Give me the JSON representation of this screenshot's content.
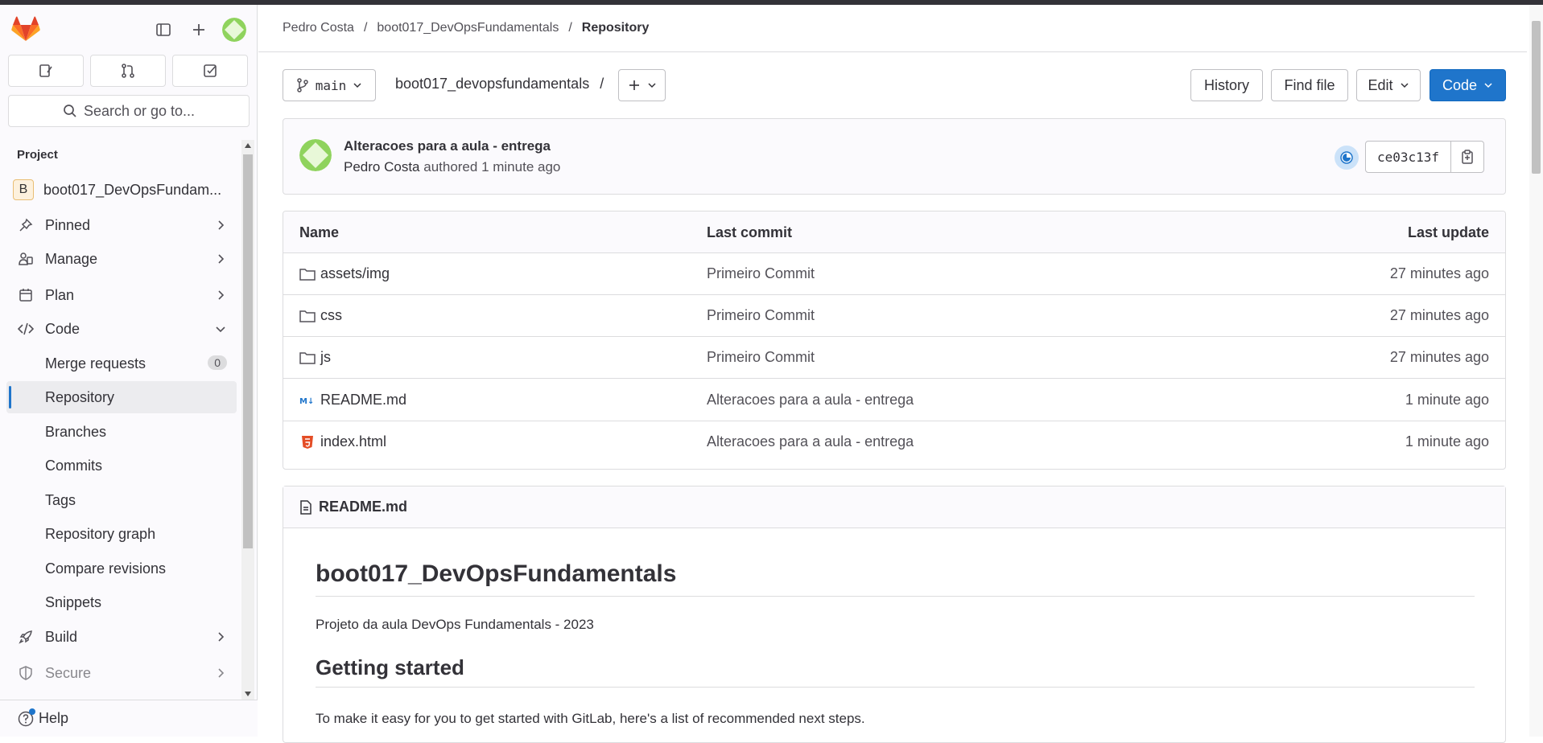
{
  "sidebar": {
    "search_label": "Search or go to...",
    "section_title": "Project",
    "project_name": "boot017_DevOpsFundam...",
    "project_initial": "B",
    "items": [
      {
        "label": "Pinned"
      },
      {
        "label": "Manage"
      },
      {
        "label": "Plan"
      },
      {
        "label": "Code"
      }
    ],
    "code_sub": [
      {
        "label": "Merge requests",
        "count": "0"
      },
      {
        "label": "Repository"
      },
      {
        "label": "Branches"
      },
      {
        "label": "Commits"
      },
      {
        "label": "Tags"
      },
      {
        "label": "Repository graph"
      },
      {
        "label": "Compare revisions"
      },
      {
        "label": "Snippets"
      }
    ],
    "build_label": "Build",
    "secure_label": "Secure",
    "help_label": "Help"
  },
  "breadcrumb": {
    "user": "Pedro Costa",
    "project": "boot017_DevOpsFundamentals",
    "current": "Repository"
  },
  "toolbar": {
    "branch": "main",
    "repo_path": "boot017_devopsfundamentals",
    "path_sep": "/",
    "history": "History",
    "find_file": "Find file",
    "edit": "Edit",
    "code": "Code"
  },
  "commit": {
    "title": "Alteracoes para a aula - entrega",
    "author": "Pedro Costa",
    "meta": "authored 1 minute ago",
    "sha": "ce03c13f"
  },
  "table": {
    "headers": {
      "name": "Name",
      "last_commit": "Last commit",
      "last_update": "Last update"
    },
    "rows": [
      {
        "name": "assets/img",
        "type": "folder",
        "commit": "Primeiro Commit",
        "update": "27 minutes ago"
      },
      {
        "name": "css",
        "type": "folder",
        "commit": "Primeiro Commit",
        "update": "27 minutes ago"
      },
      {
        "name": "js",
        "type": "folder",
        "commit": "Primeiro Commit",
        "update": "27 minutes ago"
      },
      {
        "name": "README.md",
        "type": "markdown",
        "commit": "Alteracoes para a aula - entrega",
        "update": "1 minute ago"
      },
      {
        "name": "index.html",
        "type": "html",
        "commit": "Alteracoes para a aula - entrega",
        "update": "1 minute ago"
      }
    ]
  },
  "readme": {
    "file": "README.md",
    "h1": "boot017_DevOpsFundamentals",
    "p1": "Projeto da aula DevOps Fundamentals - 2023",
    "h2": "Getting started",
    "p2": "To make it easy for you to get started with GitLab, here's a list of recommended next steps."
  },
  "colors": {
    "accent": "#1f75cb",
    "logo_orange": "#e24329"
  }
}
